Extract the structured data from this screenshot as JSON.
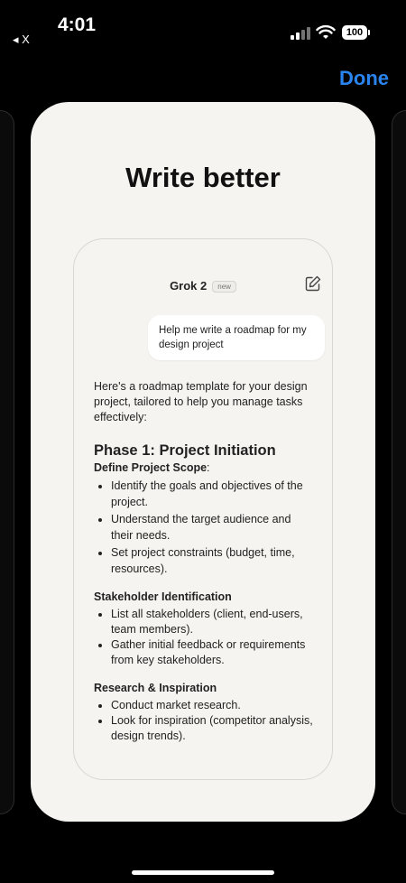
{
  "status_bar": {
    "back_label": "◂ X",
    "time": "4:01",
    "battery": "100"
  },
  "nav": {
    "done_label": "Done"
  },
  "card": {
    "headline": "Write better"
  },
  "phone": {
    "model_name": "Grok 2",
    "badge": "new",
    "user_message": "Help me write a roadmap for my design project",
    "intro": "Here's a roadmap template for your design project, tailored to help you manage tasks effectively:",
    "phase_title": "Phase 1: Project Initiation",
    "scope_label": "Define Project Scope",
    "scope_colon": ":",
    "scope_items": [
      "Identify the goals and objectives of the project.",
      " Understand the target audience and their needs.",
      "Set project constraints (budget, time, resources)."
    ],
    "stakeholder_title": "Stakeholder Identification",
    "stakeholder_items": [
      "List all stakeholders (client, end-users, team members).",
      "Gather initial feedback or requirements from key stakeholders."
    ],
    "research_title": "Research & Inspiration",
    "research_items": [
      "Conduct market research.",
      "Look for inspiration (competitor analysis, design trends)."
    ]
  },
  "colors": {
    "accent": "#2a84f0",
    "card_bg": "#f6f4f0",
    "background": "#000000"
  }
}
